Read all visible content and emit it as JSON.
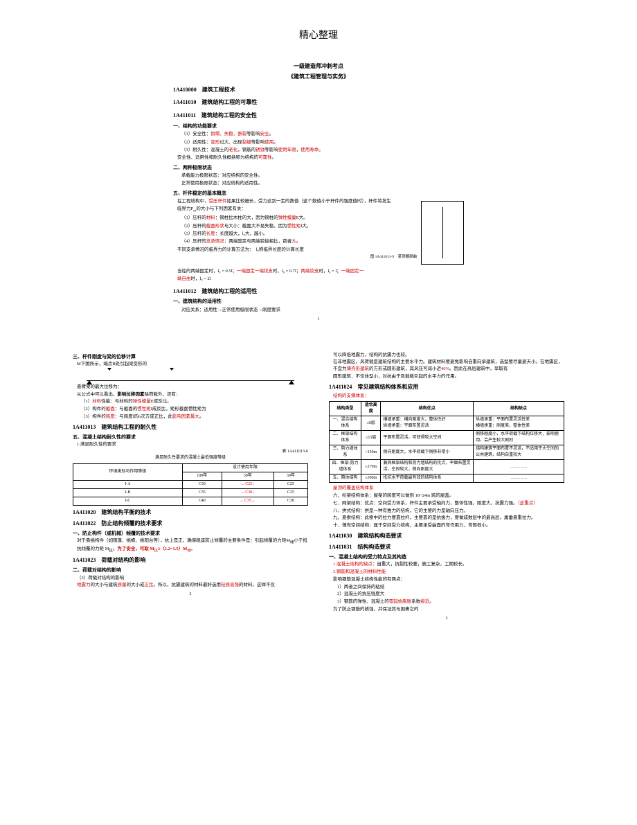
{
  "header": "精心整理",
  "top": {
    "t1": "一级建造师冲刺考点",
    "t2": "《建筑工程管理与实务》",
    "s1": "1A410000　建筑工程技术",
    "s2": "1A411010　建筑结构工程的可靠性",
    "s3": "1A411011　建筑结构工程的安全性",
    "h1": "一、结构的功能要求",
    "l1a": "（1）安全性：",
    "l1b": "倒塌、失稳、断裂",
    "l1c": "等影响",
    "l1d": "安全",
    "l1e": "。",
    "l2a": "（2）适用性：",
    "l2b": "变形",
    "l2c": "过大、出现",
    "l2d": "裂缝",
    "l2e": "等影响",
    "l2f": "使用",
    "l2g": "。",
    "l3a": "（3）耐久性：混凝土的",
    "l3b": "老化",
    "l3c": "，钢筋的",
    "l3d": "锈蚀",
    "l3e": "等影响",
    "l3f": "使用年限",
    "l3g": "，",
    "l3h": "使用寿命",
    "l3i": "。",
    "l4": "安全性、适用性和耐久性概括称为结构的",
    "l4b": "可靠性",
    "l4c": "。",
    "h2": "二、两种极限状态",
    "l5": "承载能力极限状态：对应结构的安全性。",
    "l6": "正常使用极限状态：对应结构的适用性。",
    "h3": "五、杆件稳定的基本概念",
    "f1a": "在工程结构中，",
    "f1b": "受压杆件",
    "f1c": "如果比较细长，受力达到一定的数值（这个数值小于杆件的强度值时），杆件将发生",
    "f2": "临界力P",
    "f2b": "cr",
    "f2c": "的大小与下列因素有关：",
    "c1a": "（1）压杆的",
    "c1b": "材料",
    "c1c": "：钢柱比木柱的大，因为钢柱的",
    "c1d": "弹性模量",
    "c1e": "E大。",
    "c2a": "（2）压杆的",
    "c2b": "截面形状",
    "c2c": "与大小：截面大不易失稳，因为",
    "c2d": "惯性矩",
    "c2e": "I大。",
    "c3a": "（3）压杆的",
    "c3b": "长度",
    "c3c": "：长度越大，",
    "c3d": "l₀",
    "c3e": "大，越小。",
    "c4a": "（4）压杆的",
    "c4b": "支承情况",
    "c4c": "：两端固定与两端铰接相比，前者",
    "c4d": "大",
    "c4e": "。",
    "f3": "不同支承情况的临界力的计算方法为：",
    "f3b": "l₀称临界长度的计算长度",
    "f4a": "当柱的两端固定时，l₀ = 0.5l；",
    "f4b": "一端固定一端铰支",
    "f4c": "时，l₀ = 0.7l；",
    "f4d": "两端铰支",
    "f4e": "时，l₀ = l；",
    "f4f": "一端固定一",
    "f5a": "端自由",
    "f5b": "时，l₀ = 2l",
    "s4": "1A411012　建筑结构工程的适用性",
    "h4": "一、建筑结构的适用性",
    "l7": "对应关系：适用性→正常使用极限状态→刚度要求",
    "figcap1": "图 1A411011-9　某顶棚梁曲",
    "pg1": "1"
  },
  "left": {
    "h1": "三、杆件刚度与梁的位移计算",
    "l1": "M下图所示，端点B处引起梁变形的",
    "f1": "悬臂梁的最大位移为：",
    "f2a": "从公式中可以看出，",
    "f2b": "影响位移因素",
    "f2c": "除荷载外，还有：",
    "c1a": "（1）",
    "c1b": "材料",
    "c1c": "性能：与材料的",
    "c1d": "弹性模量",
    "c1e": "E成反比。",
    "c2a": "（2）构件的",
    "c2b": "截面",
    "c2c": "：与截面的",
    "c2d": "惯性矩",
    "c2e": "I成反比，矩形截面惯性矩为",
    "c3a": "（3）构件的",
    "c3b": "跨度",
    "c3c": "：与跨度l的n次方成正比，此",
    "c3d": "影响因素最大",
    "c3e": "。",
    "s1": "1A411013　建筑结构工程的耐久性",
    "h2": "五、混凝土结构耐久性的要求",
    "l2": "1.满足耐久性的要求",
    "tcap": "表 1A411013-6",
    "ttitle": "满足耐久性要求的混凝土最低强度等级",
    "th1": "环境类别与作用等级",
    "th2": "设计使用年限",
    "th3": "100年",
    "th4": "50年",
    "th5": "30年",
    "r1a": "I-A",
    "r1b": "C30",
    "r1c": "←C25↓",
    "r1d": "C25",
    "r2a": "I-B",
    "r2b": "C35",
    "r2c": "←C30↓",
    "r2d": "C25",
    "r3a": "I-C",
    "r3b": "C40",
    "r3c": "←C35→",
    "r3d": "C30",
    "s2": "1A411020　建筑结构平衡的技术",
    "s3": "1A411022　防止结构倾覆的技术要求",
    "h3": "一、防止构件（或机械）倾覆的技术要求",
    "l3": "对于悬挑构件（如雨篷、挑檐、挑阳台等），抗上是正，确保稳座防止倾覆的主要条件是：引起倾覆的力矩M",
    "l3b": "倾",
    "l3c": "小于抵抗倾覆的力矩 M",
    "l3d": "抗",
    "l3e": "。",
    "l3f": "为了安全，可取 M",
    "l3g": "抗",
    "l3h": "≥（1.2~1.5）M",
    "l3i": "倾",
    "l3j": "。",
    "s4": "1A411023　荷载对结构的影响",
    "h4": "二、荷载对结构的影响",
    "l4": "（3）荷载对结构的影响",
    "l5a": "地震力",
    "l5b": "的大小与建筑",
    "l5c": "质量",
    "l5d": "的大小成",
    "l5e": "正比",
    "l5f": "。所以，抗震建筑的材料最好选用",
    "l5g": "轻质高强",
    "l5h": "的材料，这样不仅",
    "pg": "2"
  },
  "right": {
    "p1": "可以降低地震力，结构的抗震力也较。",
    "p2a": "在非地震区，风荷载是建筑结构的主要水平力。建筑材料要避免影响自重向承建筑，选型要尽量避天",
    "p2b": "小。在地震区，不宜为",
    "p2c": "薄壳形建筑",
    "p2d": "的方形或圆形建筑，其风压可减小近",
    "p2e": "40%",
    "p2f": "。因此在高层建筑中，早取有",
    "p3": "圆形建筑，不仅体型小，对抗由于风载载引起的水平力的作用。",
    "s1": "1A411024　常见建筑结构体系和应用",
    "h1": "结构的支撑体系：",
    "th1": "结构类型",
    "th2": "适合高度",
    "th3": "结构优点",
    "th4": "结构缺点",
    "r1a": "一、混合结构体系",
    "r1b": "≤6层",
    "r1c1": "横墙承重：横向刚度大，整体性好",
    "r1c2": "纵墙承重：平面布置灵活",
    "r1d1": "纵墙承重：平面布置灵活性差",
    "r1d2": "横墙承重：刚度差，整体性差",
    "r2a": "二、框架结构体系",
    "r2b": "≤15层",
    "r2c": "平面布置灵活，可获得较大空间",
    "r2d": "侧移刚度小，水平荷载下结构位移大，影响使用，会产生较大剧烈",
    "r3a": "三、剪力墙体系",
    "r3b": "<150m",
    "r3c": "侧向刚度大，水平荷载下侧移非常小",
    "r3d": "结构建筑平面布置不灵活，不适用于大空间的公共建筑，结构自重较大",
    "r4a": "四、框架-剪力墙体系",
    "r4b": "≤170m",
    "r4c": "兼具框架结构和剪力墙结构的优点，平面布置灵活，空间较大，侧向刚度大",
    "r4d": "…………",
    "r5a": "五、筒体结构",
    "r5b": "≤300m",
    "r5c": "抵抗水平荷载最有效的结构体系",
    "r5d": "…………",
    "h2": "屋顶的覆盖结构体系",
    "l1": "六、桁架结构体系：屋架的跨度可以做到 18~24m 跨的屋盖。",
    "l2a": "七、网架结构：优点：空间受力体系，杆件主要承受轴向力，整体性强，刚度大，抗震力强。",
    "l2b": "（这重点）",
    "l3": "八、拱式结构：拱是一种有推力的结构，它的主要的力是轴向压力。",
    "l4": "九、悬索结构：此索中的拉力要靠拉杆，主要靠的是抗拔力，要做成数层中的最高层，属垂悬重拉力。",
    "l5": "十、薄壳空间结构：属于空间受力结构，主要承受曲面的弯作用力，弯矩很小。",
    "s2": "1A411030　建筑结构构造要求",
    "s3": "1A411031　结构构造要求",
    "h3": "一、混凝土结构的受力特点及其构造",
    "l6a": "1.混凝土结构的缺点：",
    "l6b": "自重大，抗裂性较差，施工复杂，工期较长。",
    "l7": "3.钢筋和混凝土的材料性能",
    "l8": "影响钢筋混凝土结构性能的有两点：",
    "l9": "1）两者之间保持的粘结",
    "l10": "2）混凝土的抗压强度大",
    "l11a": "3）钢筋的弹性、混凝土的",
    "l11b": "零起始膨胀",
    "l11c": "系数",
    "l11d": "接近",
    "l11e": "。",
    "l12": "为了防止钢筋的锈蚀，并保证其与围裹它的",
    "pg": "3"
  }
}
